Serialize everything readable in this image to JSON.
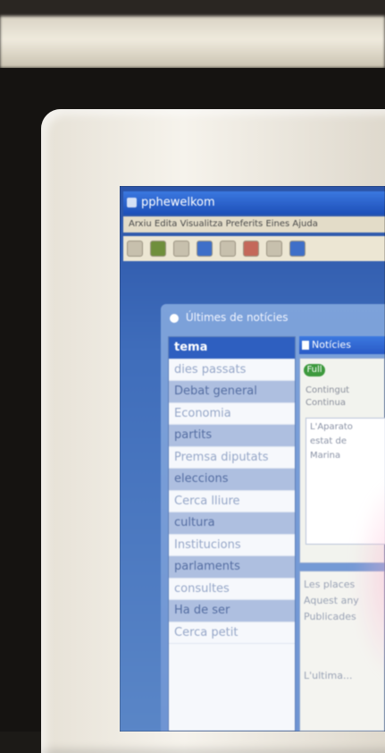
{
  "window": {
    "title": "pphewelkom",
    "menu_text": "Arxiu Edita Visualitza Preferits Eines Ajuda"
  },
  "toolbar": {
    "icons": [
      "back-icon",
      "forward-icon",
      "stop-icon",
      "refresh-icon",
      "home-icon",
      "search-icon",
      "favorites-icon",
      "history-icon"
    ]
  },
  "panel": {
    "title": "Últimes de notícies"
  },
  "topics": {
    "header": "tema",
    "items": [
      "dies passats",
      "Debat general",
      "Economia",
      "partits",
      "Premsa diputats",
      "eleccions",
      "Cerca lliure",
      "cultura",
      "Institucions",
      "parlaments",
      "consultes",
      "Ha de ser",
      "Cerca petit"
    ]
  },
  "news_panel": {
    "title": "Notícies",
    "status_label": "Full",
    "line1": "Contingut",
    "line2": "Continua",
    "box_line1": "L'Aparato",
    "box_line2": "estat de",
    "box_line3": "Marina",
    "lower_line1": "Les places",
    "lower_line2": "Aquest any",
    "lower_line3": "Publicades",
    "lower_line4": "L'ultima..."
  },
  "colors": {
    "accent": "#2e5fc0",
    "panel": "#7da2da",
    "desktop": "#3f6dbb"
  }
}
